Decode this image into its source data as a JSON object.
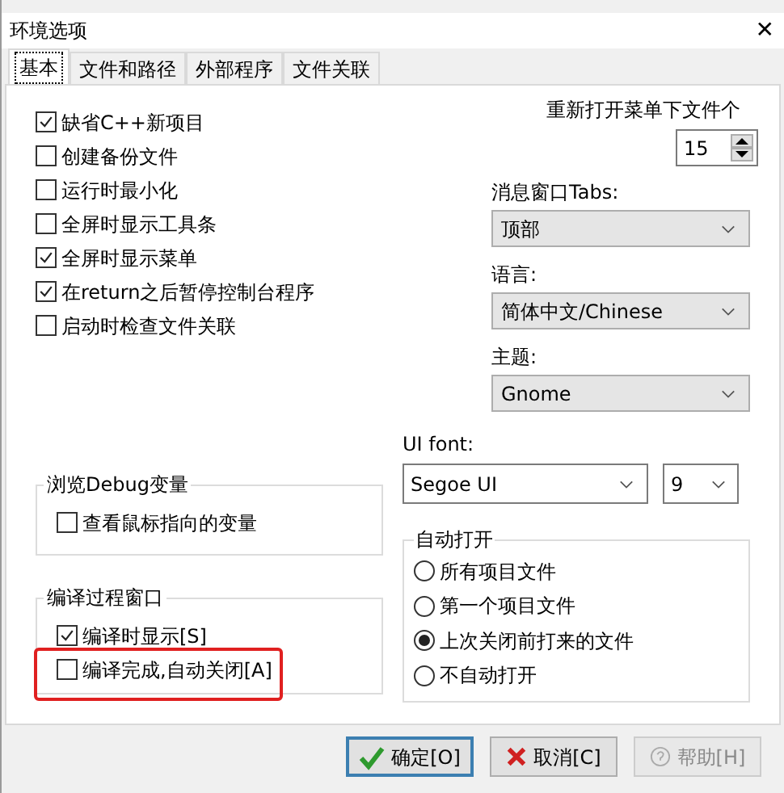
{
  "window": {
    "title": "环境选项",
    "close": "✕"
  },
  "tabs": [
    {
      "label": "基本",
      "selected": true
    },
    {
      "label": "文件和路径",
      "selected": false
    },
    {
      "label": "外部程序",
      "selected": false
    },
    {
      "label": "文件关联",
      "selected": false
    }
  ],
  "options": [
    {
      "label": "缺省C++新项目",
      "checked": true
    },
    {
      "label": "创建备份文件",
      "checked": false
    },
    {
      "label": "运行时最小化",
      "checked": false
    },
    {
      "label": "全屏时显示工具条",
      "checked": false
    },
    {
      "label": "全屏时显示菜单",
      "checked": true
    },
    {
      "label": "在return之后暂停控制台程序",
      "checked": true
    },
    {
      "label": "启动时检查文件关联",
      "checked": false
    }
  ],
  "recent_files": {
    "label": "重新打开菜单下文件个",
    "value": "15"
  },
  "dropdowns": [
    {
      "label": "消息窗口Tabs:",
      "value": "顶部"
    },
    {
      "label": "语言:",
      "value": "简体中文/Chinese"
    },
    {
      "label": "主题:",
      "value": "Gnome"
    }
  ],
  "ui_font": {
    "label": "UI font:",
    "font": "Segoe UI",
    "size": "9"
  },
  "groups": [
    {
      "title": "浏览Debug变量",
      "items": [
        {
          "label": "查看鼠标指向的变量",
          "checked": false
        }
      ]
    },
    {
      "title": "编译过程窗口",
      "items": [
        {
          "label": "编译时显示[S]",
          "checked": true
        },
        {
          "label": "编译完成,自动关闭[A]",
          "checked": false,
          "highlighted": true
        }
      ]
    }
  ],
  "auto_open": {
    "title": "自动打开",
    "options": [
      {
        "label": "所有项目文件",
        "selected": false
      },
      {
        "label": "第一个项目文件",
        "selected": false
      },
      {
        "label": "上次关闭前打来的文件",
        "selected": true
      },
      {
        "label": "不自动打开",
        "selected": false
      }
    ]
  },
  "buttons": [
    {
      "kind": "ok",
      "label": "确定[O]"
    },
    {
      "kind": "cancel",
      "label": "取消[C]"
    },
    {
      "kind": "help",
      "label": "帮助[H]"
    }
  ]
}
